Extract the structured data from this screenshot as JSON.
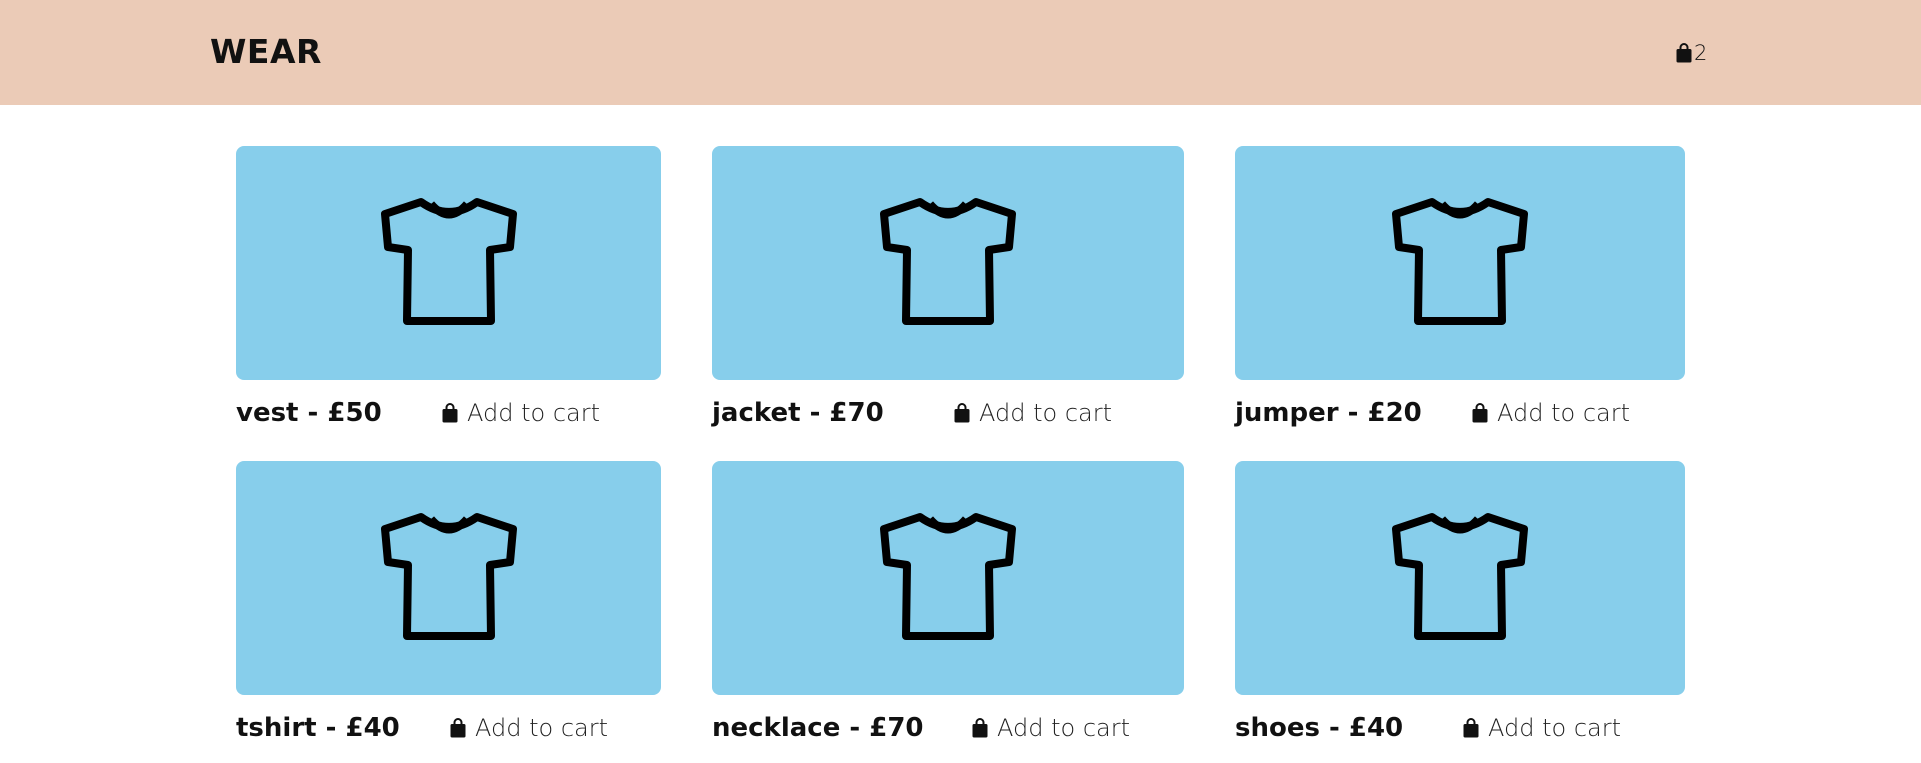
{
  "header": {
    "brand": "WEAR",
    "cart_icon": "shopping-bag-icon",
    "cart_count": "2",
    "background": "#ebcbb7"
  },
  "products": [
    {
      "title": "vest - £50",
      "add_label": "Add to cart",
      "icon": "tshirt-icon"
    },
    {
      "title": "jacket - £70",
      "add_label": "Add to cart",
      "icon": "tshirt-icon"
    },
    {
      "title": "jumper - £20",
      "add_label": "Add to cart",
      "icon": "tshirt-icon"
    },
    {
      "title": "tshirt - £40",
      "add_label": "Add to cart",
      "icon": "tshirt-icon"
    },
    {
      "title": "necklace - £70",
      "add_label": "Add to cart",
      "icon": "tshirt-icon"
    },
    {
      "title": "shoes - £40",
      "add_label": "Add to cart",
      "icon": "tshirt-icon"
    }
  ],
  "colors": {
    "card_background": "#87ceeb",
    "text": "#111111"
  }
}
